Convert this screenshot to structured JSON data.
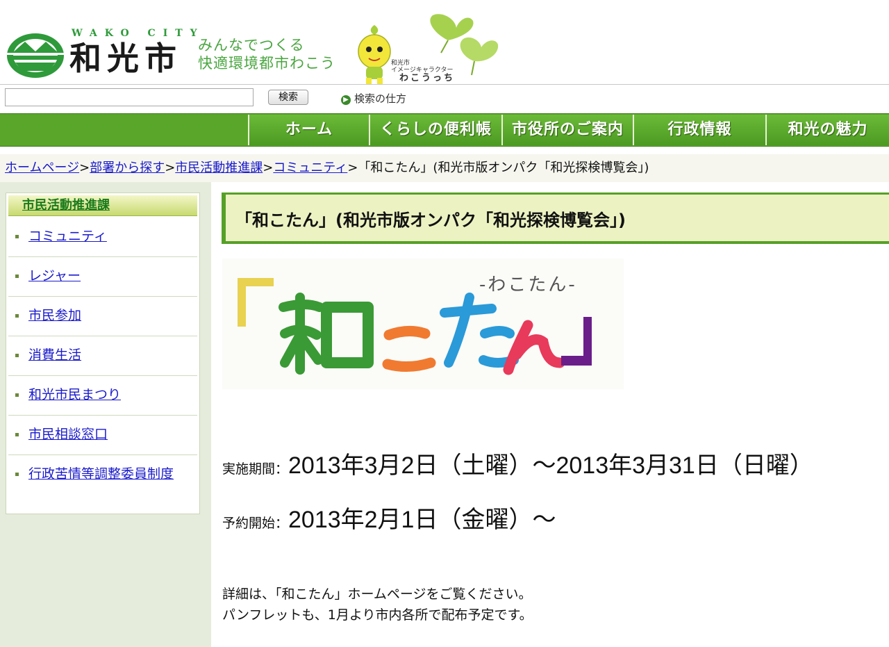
{
  "header": {
    "city_en": "WAKO CITY",
    "city_ja": "和光市",
    "slogan_line1": "みんなでつくる",
    "slogan_line2": "快適環境都市わこう",
    "mascot_caption_line1": "和光市",
    "mascot_caption_line2": "イメージキャラクター",
    "mascot_name": "わこうっち",
    "logo_icon": "wako-city-emblem-icon",
    "colors": {
      "brand_green": "#2e9a3a",
      "slogan_green": "#4aa640"
    }
  },
  "search": {
    "input_value": "",
    "button_label": "検索",
    "help_icon": "arrow-circle-icon",
    "help_label": "検索の仕方"
  },
  "nav": {
    "items": [
      {
        "label": "ホーム"
      },
      {
        "label": "くらしの便利帳"
      },
      {
        "label": "市役所のご案内"
      },
      {
        "label": "行政情報"
      },
      {
        "label": "和光の魅力"
      }
    ],
    "color": "#5aa62a"
  },
  "breadcrumb": {
    "links": [
      "ホームページ",
      "部署から探す",
      "市民活動推進課",
      "コミュニティ"
    ],
    "separator": ">",
    "current": "「和こたん」(和光市版オンパク「和光探検博覧会」)"
  },
  "sidebar": {
    "heading": "市民活動推進課",
    "items": [
      {
        "label": "コミュニティ"
      },
      {
        "label": "レジャー"
      },
      {
        "label": "市民参加"
      },
      {
        "label": "消費生活"
      },
      {
        "label": "和光市民まつり"
      },
      {
        "label": "市民相談窓口"
      },
      {
        "label": "行政苦情等調整委員制度"
      }
    ]
  },
  "main": {
    "title": "「和こたん」(和光市版オンパク「和光探検博覧会」)",
    "banner": {
      "subtitle": "-わこたん-",
      "logo_chars": [
        "和",
        "こ",
        "た",
        "ん"
      ],
      "colors": {
        "green": "#3a9a35",
        "orange": "#f07a30",
        "blue": "#2a9ad8",
        "red": "#e83a5a",
        "purple": "#6a1e8a",
        "yellow": "#e8d250"
      }
    },
    "period_label": "実施期間：",
    "period_value": "2013年3月2日（土曜）～2013年3月31日（日曜）",
    "reserve_label": "予約開始：",
    "reserve_value": "2013年2月1日（金曜）～",
    "detail_line1": "詳細は、「和こたん」ホームページをご覧ください。",
    "detail_line2": "パンフレットも、1月より市内各所で配布予定です。"
  }
}
